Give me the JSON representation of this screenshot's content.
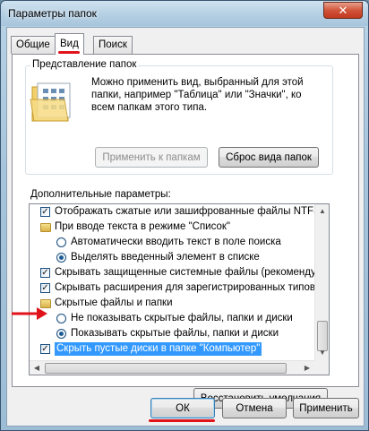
{
  "window": {
    "title": "Параметры папок",
    "close_glyph": "✕"
  },
  "tabs": [
    {
      "label": "Общие",
      "active": false
    },
    {
      "label": "Вид",
      "active": true
    },
    {
      "label": "Поиск",
      "active": false
    }
  ],
  "folder_views": {
    "group_label": "Представление папок",
    "description": "Можно применить вид, выбранный для этой папки, например \"Таблица\" или \"Значки\", ко всем папкам этого типа.",
    "apply_button": "Применить к папкам",
    "reset_button": "Сброс вида папок"
  },
  "advanced": {
    "label": "Дополнительные параметры:",
    "items": [
      {
        "type": "checkbox",
        "checked": true,
        "text": "Отображать сжатые или зашифрованные файлы NTFS"
      },
      {
        "type": "folder",
        "text": "При вводе текста в режиме \"Список\""
      },
      {
        "type": "radio",
        "checked": false,
        "text": "Автоматически вводить текст в поле поиска"
      },
      {
        "type": "radio",
        "checked": true,
        "text": "Выделять введенный элемент в списке"
      },
      {
        "type": "checkbox",
        "checked": true,
        "text": "Скрывать защищенные системные файлы (рекомендуется)"
      },
      {
        "type": "checkbox",
        "checked": true,
        "text": "Скрывать расширения для зарегистрированных типов"
      },
      {
        "type": "folder",
        "text": "Скрытые файлы и папки"
      },
      {
        "type": "radio",
        "checked": false,
        "text": "Не показывать скрытые файлы, папки и диски"
      },
      {
        "type": "radio",
        "checked": true,
        "text": "Показывать скрытые файлы, папки и диски"
      },
      {
        "type": "checkbox",
        "checked": true,
        "text": "Скрыть пустые диски в папке \"Компьютер\"",
        "selected": true
      }
    ],
    "restore_button": "Восстановить умолчания"
  },
  "footer": {
    "ok": "ОК",
    "cancel": "Отмена",
    "apply": "Применить"
  },
  "annotation_color": "#e0131b",
  "selection_color": "#3399ff"
}
